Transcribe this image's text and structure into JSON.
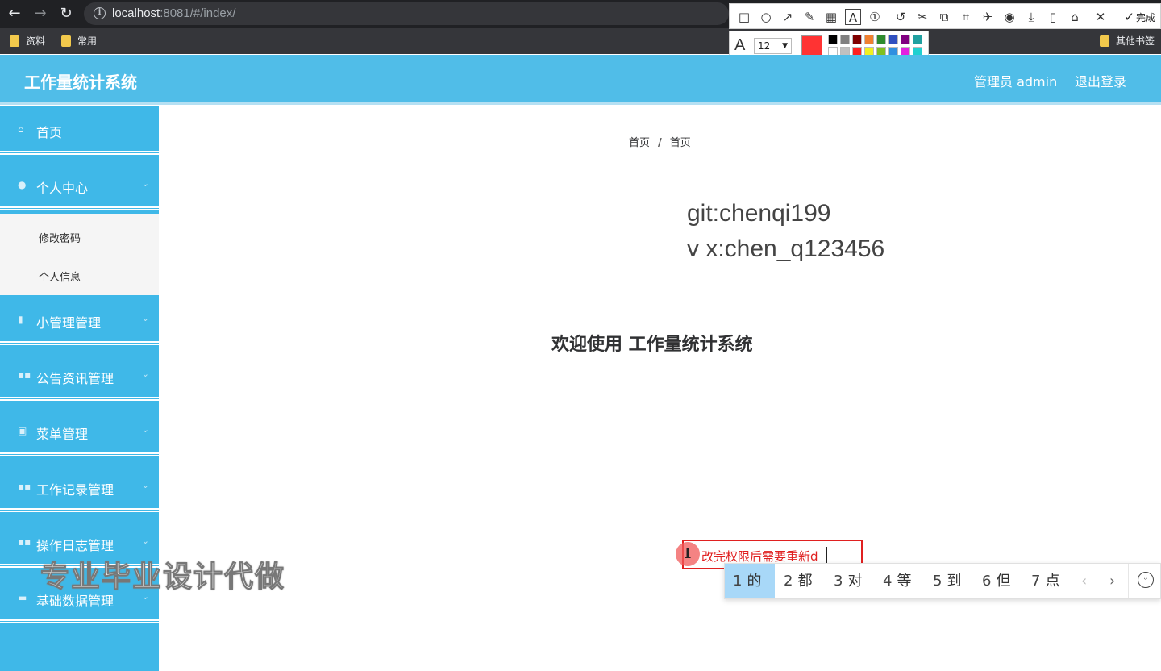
{
  "browser": {
    "url_host": "localhost",
    "url_rest": ":8081/#/index/",
    "bookmarks": [
      "资料",
      "常用"
    ],
    "other_bookmarks": "其他书签"
  },
  "screenshot_tool": {
    "done_label": "完成",
    "font_size": "12",
    "current_color": "#ff3333",
    "palette_top": [
      "#000000",
      "#808080",
      "#800000",
      "#f08030",
      "#2e8b2e",
      "#3050c0",
      "#800080",
      "#20a0a0"
    ],
    "palette_bottom": [
      "#ffffff",
      "#c0c0c0",
      "#ff2020",
      "#f0f020",
      "#80c020",
      "#3090e0",
      "#e020e0",
      "#20d0d0"
    ]
  },
  "header": {
    "title": "工作量统计系统",
    "user": "管理员 admin",
    "logout": "退出登录"
  },
  "sidebar": {
    "items": [
      {
        "label": "首页",
        "icon": "home-icon"
      },
      {
        "label": "个人中心",
        "icon": "user-icon"
      },
      {
        "label": "小管理管理",
        "icon": "book-icon"
      },
      {
        "label": "公告资讯管理",
        "icon": "grid-icon"
      },
      {
        "label": "菜单管理",
        "icon": "clipboard-icon"
      },
      {
        "label": "工作记录管理",
        "icon": "grid-icon"
      },
      {
        "label": "操作日志管理",
        "icon": "grid-icon"
      },
      {
        "label": "基础数据管理",
        "icon": "chat-icon"
      }
    ],
    "submenu": [
      "修改密码",
      "个人信息"
    ]
  },
  "main": {
    "breadcrumb": [
      "首页",
      "首页"
    ],
    "breadcrumb_sep": "/",
    "git": "git:chenqi199",
    "vx": "v x:chen_q123456",
    "welcome": "欢迎使用 工作量统计系统"
  },
  "watermark": "专业毕业设计代做",
  "annotation": {
    "text": "改完权限后需要重新d"
  },
  "ime": {
    "candidates": [
      {
        "num": "1",
        "char": "的"
      },
      {
        "num": "2",
        "char": "都"
      },
      {
        "num": "3",
        "char": "对"
      },
      {
        "num": "4",
        "char": "等"
      },
      {
        "num": "5",
        "char": "到"
      },
      {
        "num": "6",
        "char": "但"
      },
      {
        "num": "7",
        "char": "点"
      }
    ]
  }
}
